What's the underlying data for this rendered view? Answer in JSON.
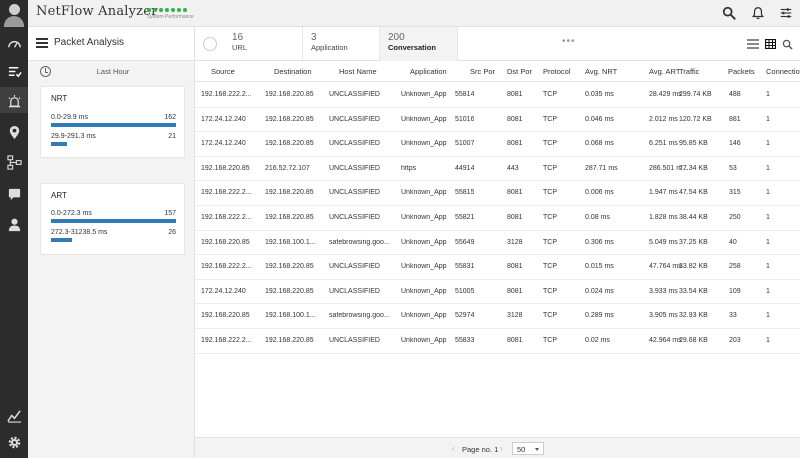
{
  "app": {
    "title": "NetFlow Analyzer",
    "subtitle": "System Performance",
    "status_color": "#35b146",
    "accent_color": "#2e7db8"
  },
  "top_icons": [
    "search-icon",
    "bell-icon",
    "sliders-icon"
  ],
  "nav_icons": [
    "dashboard-icon",
    "inventory-icon",
    "alarm-icon",
    "map-pin-icon",
    "network-icon",
    "chat-icon",
    "user-icon",
    "reports-icon",
    "settings-icon"
  ],
  "panel": {
    "title": "Packet Analysis",
    "timeframe": "Last Hour",
    "nrt": {
      "title": "NRT",
      "ranges": [
        {
          "label": "0.0-29.9 ms",
          "count": "162",
          "fraction": 1.0
        },
        {
          "label": "29.9-291.3 ms",
          "count": "21",
          "fraction": 0.13
        }
      ]
    },
    "art": {
      "title": "ART",
      "ranges": [
        {
          "label": "0.0-272.3 ms",
          "count": "157",
          "fraction": 1.0
        },
        {
          "label": "272.3-31238.5 ms",
          "count": "26",
          "fraction": 0.17
        }
      ]
    }
  },
  "tabs": [
    {
      "count": "16",
      "label": "URL"
    },
    {
      "count": "3",
      "label": "Application"
    },
    {
      "count": "200",
      "label": "Conversation",
      "active": true
    }
  ],
  "table": {
    "headers": [
      "Source",
      "Destination",
      "Host Name",
      "Application",
      "Src Por",
      "Dst Por",
      "Protocol",
      "Avg. NRT",
      "Avg. ART",
      "Traffic",
      "Packets",
      "Connectio"
    ],
    "rows": [
      [
        "192.168.222.2...",
        "192.168.220.85",
        "UNCLASSIFIED",
        "Unknown_App",
        "55814",
        "8081",
        "TCP",
        "0.035 ms",
        "28.429 ms",
        "299.74 KB",
        "488",
        "1"
      ],
      [
        "172.24.12.240",
        "192.168.220.85",
        "UNCLASSIFIED",
        "Unknown_App",
        "51016",
        "8081",
        "TCP",
        "0.046 ms",
        "2.012 ms",
        "120.72 KB",
        "881",
        "1"
      ],
      [
        "172.24.12.240",
        "192.168.220.85",
        "UNCLASSIFIED",
        "Unknown_App",
        "51007",
        "8081",
        "TCP",
        "0.068 ms",
        "6.251 ms",
        "95.85 KB",
        "146",
        "1"
      ],
      [
        "192.168.220.85",
        "216.52.72.107",
        "UNCLASSIFIED",
        "https",
        "44914",
        "443",
        "TCP",
        "287.71 ms",
        "286.501 m...",
        "77.34 KB",
        "53",
        "1"
      ],
      [
        "192.168.222.2...",
        "192.168.220.85",
        "UNCLASSIFIED",
        "Unknown_App",
        "55815",
        "8081",
        "TCP",
        "0.006 ms",
        "1.947 ms",
        "47.54 KB",
        "315",
        "1"
      ],
      [
        "192.168.222.2...",
        "192.168.220.85",
        "UNCLASSIFIED",
        "Unknown_App",
        "55821",
        "8081",
        "TCP",
        "0.08 ms",
        "1.828 ms",
        "38.44 KB",
        "250",
        "1"
      ],
      [
        "192.168.220.85",
        "192.168.100.1...",
        "safebrowsing.goo...",
        "Unknown_App",
        "55649",
        "3128",
        "TCP",
        "0.306 ms",
        "5.049 ms",
        "37.25 KB",
        "40",
        "1"
      ],
      [
        "192.168.222.2...",
        "192.168.220.85",
        "UNCLASSIFIED",
        "Unknown_App",
        "55831",
        "8081",
        "TCP",
        "0.015 ms",
        "47.764 ms",
        "33.82 KB",
        "258",
        "1"
      ],
      [
        "172.24.12.240",
        "192.168.220.85",
        "UNCLASSIFIED",
        "Unknown_App",
        "51005",
        "8081",
        "TCP",
        "0.024 ms",
        "3.933 ms",
        "33.54 KB",
        "109",
        "1"
      ],
      [
        "192.168.220.85",
        "192.168.100.1...",
        "safebrowsing.goo...",
        "Unknown_App",
        "52974",
        "3128",
        "TCP",
        "0.289 ms",
        "3.905 ms",
        "32.93 KB",
        "33",
        "1"
      ],
      [
        "192.168.222.2...",
        "192.168.220.85",
        "UNCLASSIFIED",
        "Unknown_App",
        "55833",
        "8081",
        "TCP",
        "0.02 ms",
        "42.964 ms",
        "29.68 KB",
        "203",
        "1"
      ]
    ]
  },
  "pagination": {
    "label": "Page no. 1",
    "page_size": "50"
  }
}
